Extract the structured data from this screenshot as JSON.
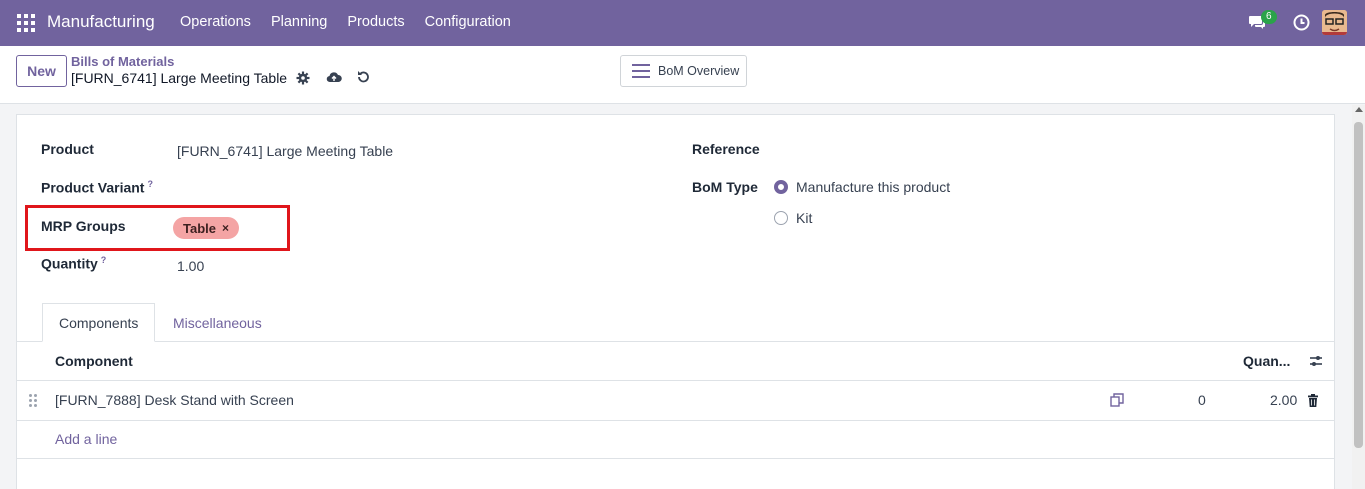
{
  "navbar": {
    "app_name": "Manufacturing",
    "menu": [
      "Operations",
      "Planning",
      "Products",
      "Configuration"
    ],
    "chat_count": "6",
    "icons": [
      "apps-grid-icon",
      "chat-icon",
      "clock-icon",
      "user-avatar"
    ]
  },
  "control": {
    "new_label": "New",
    "breadcrumb_parent": "Bills of Materials",
    "breadcrumb_current": "[FURN_6741] Large Meeting Table",
    "bom_overview_label": "BoM Overview"
  },
  "form": {
    "product_label": "Product",
    "product_value": "[FURN_6741] Large Meeting Table",
    "variant_label": "Product Variant",
    "help_mark": "?",
    "mrp_groups_label": "MRP Groups",
    "mrp_tag": "Table",
    "tag_remove": "×",
    "quantity_label": "Quantity",
    "quantity_value": "1.00",
    "reference_label": "Reference",
    "bom_type_label": "BoM Type",
    "bom_type_options": [
      "Manufacture this product",
      "Kit"
    ],
    "bom_type_selected": "Manufacture this product"
  },
  "tabs": [
    "Components",
    "Miscellaneous"
  ],
  "components_table": {
    "headers": {
      "component": "Component",
      "quantity": "Quan..."
    },
    "rows": [
      {
        "component": "[FURN_7888] Desk Stand with Screen",
        "count": "0",
        "quantity": "2.00"
      }
    ],
    "add_line": "Add a line"
  },
  "colors": {
    "brand": "#71639e",
    "tag": "#f4a4a4",
    "highlight": "#e0161b"
  }
}
